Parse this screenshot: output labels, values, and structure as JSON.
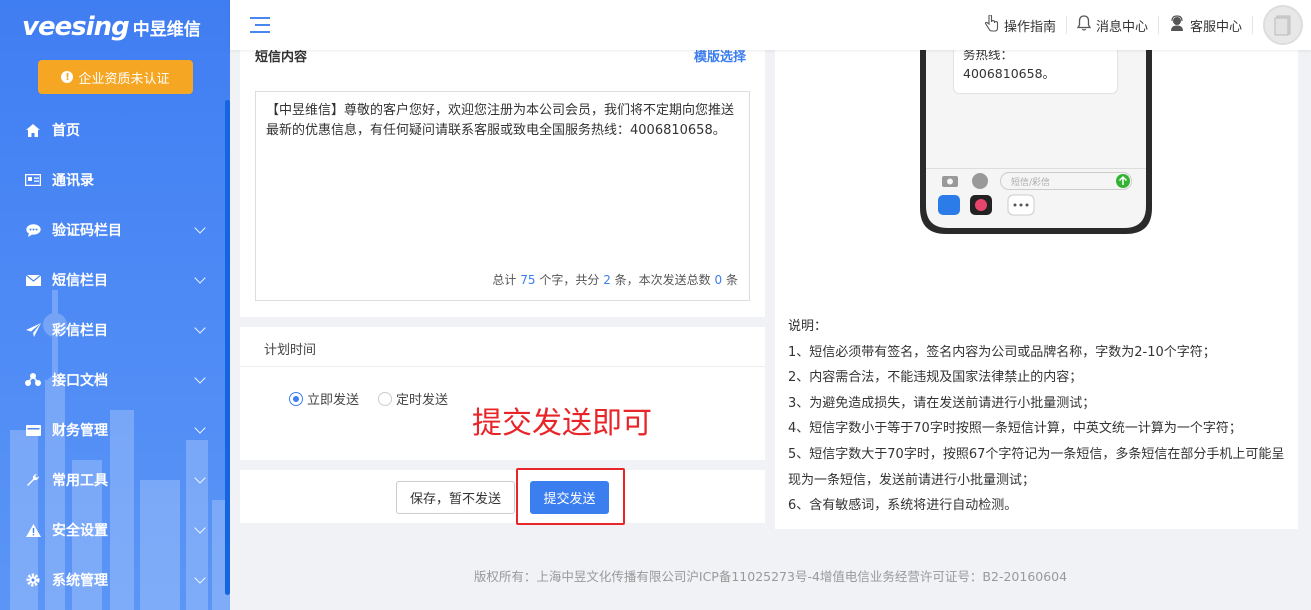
{
  "sidebar": {
    "logo_en": "veesing",
    "logo_cn": "中昱维信",
    "cert_button": "企业资质未认证",
    "items": [
      {
        "label": "首页",
        "icon": "home-icon",
        "has_children": false
      },
      {
        "label": "通讯录",
        "icon": "address-book-icon",
        "has_children": false
      },
      {
        "label": "验证码栏目",
        "icon": "chat-icon",
        "has_children": true
      },
      {
        "label": "短信栏目",
        "icon": "envelope-icon",
        "has_children": true
      },
      {
        "label": "彩信栏目",
        "icon": "paper-plane-icon",
        "has_children": true
      },
      {
        "label": "接口文档",
        "icon": "sitemap-icon",
        "has_children": true
      },
      {
        "label": "财务管理",
        "icon": "wallet-icon",
        "has_children": true
      },
      {
        "label": "常用工具",
        "icon": "wrench-icon",
        "has_children": true
      },
      {
        "label": "安全设置",
        "icon": "warning-icon",
        "has_children": true
      },
      {
        "label": "系统管理",
        "icon": "gear-icon",
        "has_children": true
      }
    ]
  },
  "header": {
    "guide": "操作指南",
    "messages": "消息中心",
    "service": "客服中心"
  },
  "sms": {
    "title": "短信内容",
    "template_link": "模版选择",
    "content": "【中昱维信】尊敬的客户您好，欢迎您注册为本公司会员，我们将不定期向您推送最新的优惠信息，有任何疑问请联系客服或致电全国服务热线：4006810658。",
    "counter": {
      "prefix": "总计",
      "chars": "75",
      "mid1": "个字，共分",
      "parts": "2",
      "mid2": "条，本次发送总数",
      "total": "0",
      "suffix": "条"
    }
  },
  "schedule": {
    "title": "计划时间",
    "option_now": "立即发送",
    "option_timed": "定时发送",
    "selected": "立即发送"
  },
  "annotation": "提交发送即可",
  "actions": {
    "save": "保存，暂不发送",
    "submit": "提交发送"
  },
  "preview": {
    "bubble_line1": "务热线：",
    "bubble_line2": "4006810658。",
    "input_placeholder": "短信/彩信"
  },
  "explain": {
    "title": "说明：",
    "lines": [
      "1、短信必须带有签名，签名内容为公司或品牌名称，字数为2-10个字符；",
      "2、内容需合法，不能违规及国家法律禁止的内容；",
      "3、为避免造成损失，请在发送前请进行小批量测试；",
      "4、短信字数小于等于70字时按照一条短信计算，中英文统一计算为一个字符；",
      "5、短信字数大于70字时，按照67个字符记为一条短信，多条短信在部分手机上可能呈现为一条短信，发送前请进行小批量测试；",
      "6、含有敏感词，系统将进行自动检测。"
    ]
  },
  "footer": "版权所有：上海中昱文化传播有限公司沪ICP备11025273号-4增值电信业务经营许可证号：B2-20160604",
  "colors": {
    "accent": "#3b7ef0",
    "sidebar": "#4a86f0",
    "warning": "#f5a623",
    "annotation_red": "#e8262a"
  }
}
